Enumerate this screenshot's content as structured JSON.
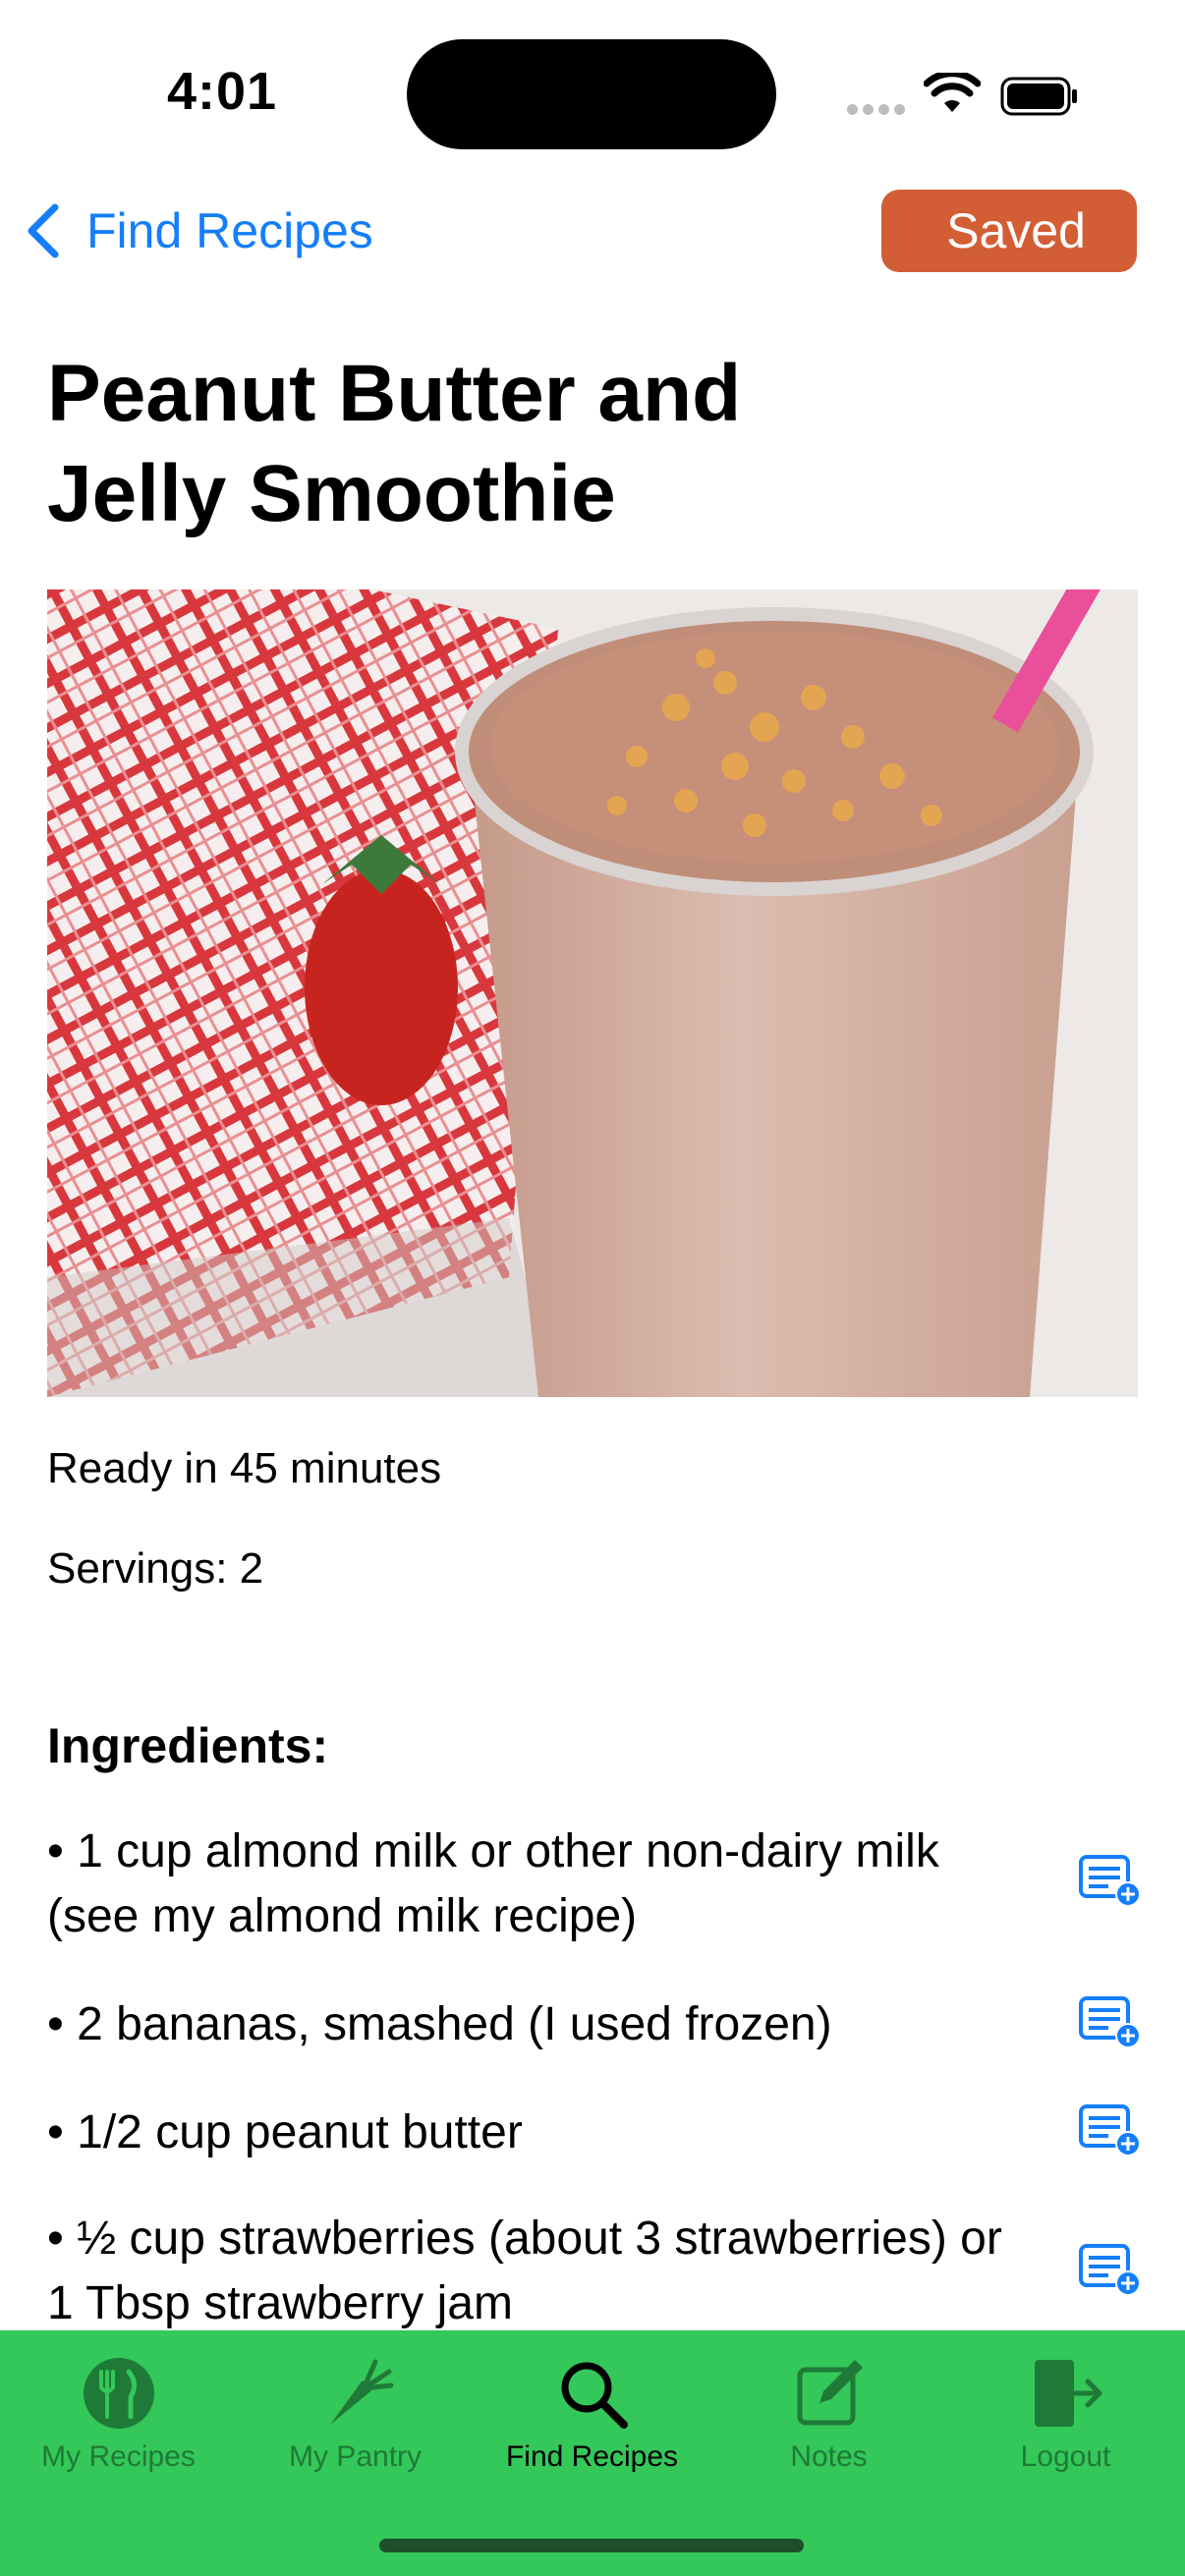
{
  "status_bar": {
    "time": "4:01"
  },
  "nav": {
    "back_label": "Find Recipes",
    "saved_label": "Saved",
    "saved_color": "#d35e35",
    "link_color": "#147efb"
  },
  "recipe": {
    "title": "Peanut Butter and Jelly Smoothie",
    "ready_in": "Ready in 45 minutes",
    "servings": "Servings: 2",
    "ingredients_heading": "Ingredients:",
    "ingredients": [
      "• 1 cup almond milk or other non-dairy milk (see my almond milk recipe)",
      "• 2 bananas, smashed (I used frozen)",
      "• 1/2 cup peanut butter",
      "• ½ cup strawberries (about 3 strawberries) or 1 Tbsp strawberry jam"
    ]
  },
  "tab_bar": {
    "background": "#34c759",
    "tabs": [
      {
        "label": "My Recipes",
        "icon": "fork-knife-icon"
      },
      {
        "label": "My Pantry",
        "icon": "carrot-icon"
      },
      {
        "label": "Find Recipes",
        "icon": "magnifier-icon",
        "active": true
      },
      {
        "label": "Notes",
        "icon": "compose-icon"
      },
      {
        "label": "Logout",
        "icon": "logout-icon"
      }
    ]
  }
}
